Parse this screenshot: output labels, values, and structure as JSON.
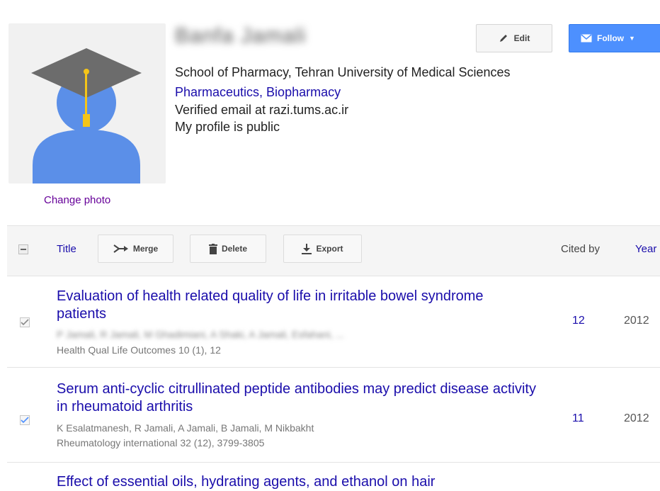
{
  "profile": {
    "name": "Banfa Jamali",
    "change_photo": "Change photo",
    "affiliation": "School of Pharmacy, Tehran University of Medical Sciences",
    "interests": "Pharmaceutics, Biopharmacy",
    "email": "Verified email at razi.tums.ac.ir",
    "visibility": "My profile is public",
    "edit_label": "Edit",
    "follow_label": "Follow",
    "avatar_icon": "graduation-cap-avatar",
    "avatar_colors": {
      "body": "#5b8fe8",
      "cap": "#6c6c6c",
      "tassel": "#f5c518"
    }
  },
  "table": {
    "col_title": "Title",
    "merge_label": "Merge",
    "delete_label": "Delete",
    "export_label": "Export",
    "col_cited_by": "Cited by",
    "col_year": "Year"
  },
  "articles": [
    {
      "title": "Evaluation of health related quality of life in irritable bowel syndrome patients",
      "authors": "P Jamali, R Jamali, M Ghadimiani, A Shaki, A Jamali, Esfahani, ...",
      "venue": "Health Qual Life Outcomes 10 (1), 12",
      "cited_by": "12",
      "year": "2012",
      "checked": true
    },
    {
      "title": "Serum anti-cyclic citrullinated peptide antibodies may predict disease activity in rheumatoid arthritis",
      "authors": "K Esalatmanesh, R Jamali, A Jamali, B Jamali, M Nikbakht",
      "venue": "Rheumatology international 32 (12), 3799-3805",
      "cited_by": "11",
      "year": "2012",
      "checked": true
    },
    {
      "title": "Effect of essential oils, hydrating agents, and ethanol on hair"
    }
  ],
  "colors": {
    "link": "#1a0dab",
    "visited": "#660099",
    "follow_button": "#4d90fe",
    "header_bar": "#f5f5f5"
  }
}
